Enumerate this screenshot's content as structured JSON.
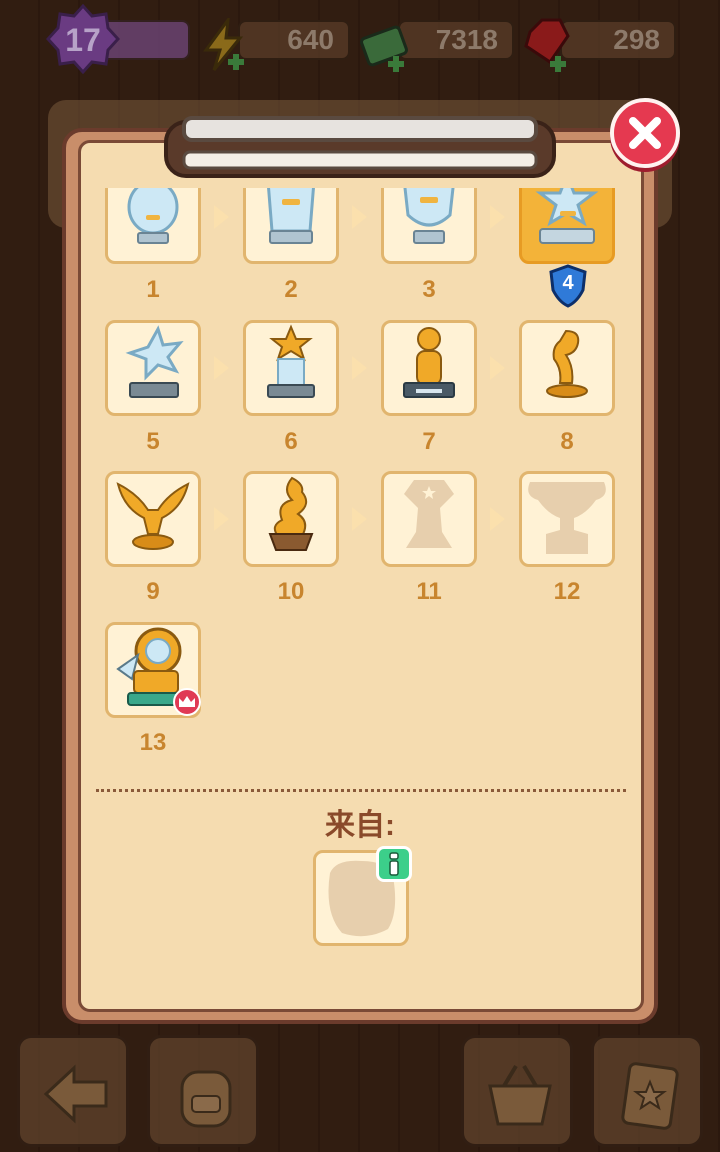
{
  "status": {
    "level": "17",
    "energy": "640",
    "cash": "7318",
    "gems": "298"
  },
  "modal": {
    "close_icon": "close-icon",
    "source_label": "来自:",
    "info_icon": "info-icon"
  },
  "trophies": [
    {
      "number": "1",
      "state": "unlocked",
      "style": "crystal-round"
    },
    {
      "number": "2",
      "state": "unlocked",
      "style": "crystal-plaque"
    },
    {
      "number": "3",
      "state": "unlocked",
      "style": "crystal-shield"
    },
    {
      "number": "4",
      "state": "current",
      "style": "crystal-star",
      "level_badge": "4"
    },
    {
      "number": "5",
      "state": "unlocked",
      "style": "crystal-star-stand"
    },
    {
      "number": "6",
      "state": "unlocked",
      "style": "gold-star-crystal"
    },
    {
      "number": "7",
      "state": "unlocked",
      "style": "gold-figure"
    },
    {
      "number": "8",
      "state": "unlocked",
      "style": "gold-abstract"
    },
    {
      "number": "9",
      "state": "unlocked",
      "style": "gold-winged"
    },
    {
      "number": "10",
      "state": "unlocked",
      "style": "gold-flame"
    },
    {
      "number": "11",
      "state": "locked",
      "style": "silhouette-star"
    },
    {
      "number": "12",
      "state": "locked",
      "style": "silhouette-cup"
    },
    {
      "number": "13",
      "state": "special",
      "style": "gold-ring",
      "crown_badge": true
    }
  ],
  "colors": {
    "slot_bg": "#fff2d5",
    "slot_border": "#e1b56e",
    "current_bg": "#f3b339",
    "number_text": "#c8852e",
    "close_button": "#e53950",
    "info_button": "#3ccf8a"
  }
}
